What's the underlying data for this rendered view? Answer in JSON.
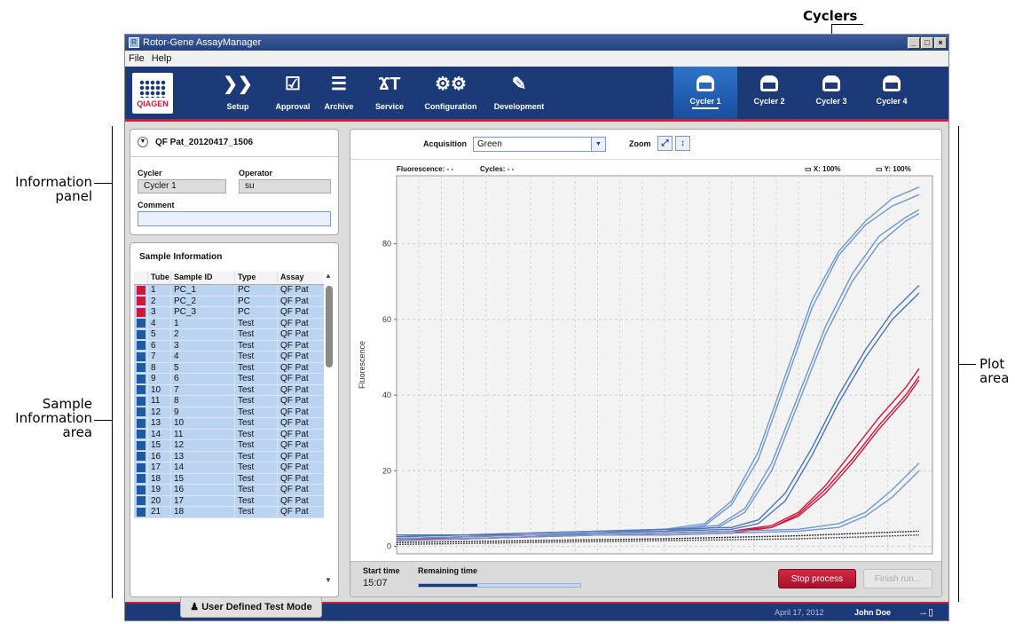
{
  "callouts": {
    "cyclers": "Cyclers",
    "information_panel": [
      "Information",
      "panel"
    ],
    "sample_information_area": [
      "Sample",
      "Information",
      "area"
    ],
    "plot_area": [
      "Plot",
      "area"
    ]
  },
  "window": {
    "title": "Rotor-Gene AssayManager",
    "controls": [
      "_",
      "□",
      "×"
    ]
  },
  "menu": [
    "File",
    "Help"
  ],
  "toolbar": {
    "logo": "QIAGEN",
    "tools": [
      {
        "label": "Setup",
        "icon": "setup-chevrons-icon",
        "glyph": "❯❯"
      },
      {
        "label": "Approval",
        "icon": "approval-check-icon",
        "glyph": "☑"
      },
      {
        "label": "Archive",
        "icon": "archive-cabinet-icon",
        "glyph": "☰"
      },
      {
        "label": "Service",
        "icon": "service-tools-icon",
        "glyph": "ϪT"
      },
      {
        "label": "Configuration",
        "icon": "configuration-gears-icon",
        "glyph": "⚙⚙"
      },
      {
        "label": "Development",
        "icon": "development-edit-icon",
        "glyph": "✎"
      }
    ],
    "cyclers": [
      "Cycler 1",
      "Cycler 2",
      "Cycler 3",
      "Cycler 4"
    ],
    "active_cycler": 0
  },
  "info_panel": {
    "experiment": "QF Pat_20120417_1506",
    "cycler_label": "Cycler",
    "cycler_value": "Cycler 1",
    "operator_label": "Operator",
    "operator_value": "su",
    "comment_label": "Comment",
    "comment_value": ""
  },
  "sample_panel": {
    "title": "Sample Information",
    "columns": [
      "Tube",
      "Sample ID",
      "Type",
      "Assay"
    ],
    "rows": [
      {
        "tube": "1",
        "id": "PC_1",
        "type": "PC",
        "assay": "QF Pat",
        "color": "#d1163a"
      },
      {
        "tube": "2",
        "id": "PC_2",
        "type": "PC",
        "assay": "QF Pat",
        "color": "#d1163a"
      },
      {
        "tube": "3",
        "id": "PC_3",
        "type": "PC",
        "assay": "QF Pat",
        "color": "#d1163a"
      },
      {
        "tube": "4",
        "id": "1",
        "type": "Test",
        "assay": "QF Pat",
        "color": "#1e5aa8"
      },
      {
        "tube": "5",
        "id": "2",
        "type": "Test",
        "assay": "QF Pat",
        "color": "#1e5aa8"
      },
      {
        "tube": "6",
        "id": "3",
        "type": "Test",
        "assay": "QF Pat",
        "color": "#1e5aa8"
      },
      {
        "tube": "7",
        "id": "4",
        "type": "Test",
        "assay": "QF Pat",
        "color": "#1e5aa8"
      },
      {
        "tube": "8",
        "id": "5",
        "type": "Test",
        "assay": "QF Pat",
        "color": "#1e5aa8"
      },
      {
        "tube": "9",
        "id": "6",
        "type": "Test",
        "assay": "QF Pat",
        "color": "#1e5aa8"
      },
      {
        "tube": "10",
        "id": "7",
        "type": "Test",
        "assay": "QF Pat",
        "color": "#1e5aa8"
      },
      {
        "tube": "11",
        "id": "8",
        "type": "Test",
        "assay": "QF Pat",
        "color": "#1e5aa8"
      },
      {
        "tube": "12",
        "id": "9",
        "type": "Test",
        "assay": "QF Pat",
        "color": "#1e5aa8"
      },
      {
        "tube": "13",
        "id": "10",
        "type": "Test",
        "assay": "QF Pat",
        "color": "#1e5aa8"
      },
      {
        "tube": "14",
        "id": "11",
        "type": "Test",
        "assay": "QF Pat",
        "color": "#1e5aa8"
      },
      {
        "tube": "15",
        "id": "12",
        "type": "Test",
        "assay": "QF Pat",
        "color": "#1e5aa8"
      },
      {
        "tube": "16",
        "id": "13",
        "type": "Test",
        "assay": "QF Pat",
        "color": "#1e5aa8"
      },
      {
        "tube": "17",
        "id": "14",
        "type": "Test",
        "assay": "QF Pat",
        "color": "#1e5aa8"
      },
      {
        "tube": "18",
        "id": "15",
        "type": "Test",
        "assay": "QF Pat",
        "color": "#1e5aa8"
      },
      {
        "tube": "19",
        "id": "16",
        "type": "Test",
        "assay": "QF Pat",
        "color": "#1e5aa8"
      },
      {
        "tube": "20",
        "id": "17",
        "type": "Test",
        "assay": "QF Pat",
        "color": "#1e5aa8"
      },
      {
        "tube": "21",
        "id": "18",
        "type": "Test",
        "assay": "QF Pat",
        "color": "#1e5aa8"
      }
    ]
  },
  "plot_panel": {
    "acquisition_label": "Acquisition",
    "acquisition_value": "Green",
    "zoom_label": "Zoom",
    "fluorescence_readout": "Fluorescence: - -",
    "cycles_readout": "Cycles: - -",
    "x_zoom": "X: 100%",
    "y_zoom": "Y: 100%",
    "start_time_label": "Start time",
    "start_time_value": "15:07",
    "remaining_label": "Remaining time",
    "remaining_progress": 0.36,
    "stop_button": "Stop process",
    "finish_button": "Finish run..."
  },
  "chart_data": {
    "type": "line",
    "ylabel": "Fluorescence",
    "xlabel": "",
    "ylim": [
      -2,
      98
    ],
    "xlim": [
      0,
      40
    ],
    "y_ticks": [
      0,
      20,
      40,
      60,
      80
    ],
    "grid": true,
    "series": [
      {
        "color": "#6f97cf",
        "x": [
          0,
          5,
          10,
          15,
          20,
          23,
          25,
          27,
          29,
          31,
          33,
          35,
          37,
          39
        ],
        "y": [
          3,
          3,
          3.5,
          4,
          4.5,
          6,
          12,
          25,
          45,
          65,
          78,
          86,
          92,
          95
        ]
      },
      {
        "color": "#6f97cf",
        "x": [
          0,
          5,
          10,
          15,
          20,
          23,
          25,
          27,
          29,
          31,
          33,
          35,
          37,
          39
        ],
        "y": [
          2.5,
          3,
          3,
          3.5,
          4,
          5.5,
          11,
          23,
          43,
          63,
          77,
          85,
          90,
          93
        ]
      },
      {
        "color": "#6f97cf",
        "x": [
          0,
          5,
          10,
          15,
          20,
          24,
          26,
          28,
          30,
          32,
          34,
          36,
          38,
          39
        ],
        "y": [
          2,
          2.5,
          3,
          3.5,
          4.5,
          5.5,
          10,
          22,
          40,
          58,
          72,
          82,
          87,
          89
        ]
      },
      {
        "color": "#6f97cf",
        "x": [
          0,
          5,
          10,
          15,
          20,
          24,
          26,
          28,
          30,
          32,
          34,
          36,
          38,
          39
        ],
        "y": [
          2,
          2.5,
          3,
          3.5,
          4,
          5,
          9,
          20,
          38,
          56,
          70,
          80,
          86,
          88
        ]
      },
      {
        "color": "#4a76b8",
        "x": [
          0,
          5,
          10,
          15,
          20,
          25,
          27,
          29,
          31,
          33,
          35,
          37,
          39
        ],
        "y": [
          3,
          3,
          3.5,
          4,
          4.5,
          5,
          7,
          14,
          26,
          40,
          52,
          62,
          69
        ]
      },
      {
        "color": "#4a76b8",
        "x": [
          0,
          5,
          10,
          15,
          20,
          25,
          27,
          29,
          31,
          33,
          35,
          37,
          39
        ],
        "y": [
          2.5,
          3,
          3,
          3.5,
          4,
          4.5,
          6,
          12,
          24,
          38,
          50,
          60,
          67
        ]
      },
      {
        "color": "#d1163a",
        "x": [
          0,
          5,
          10,
          15,
          20,
          25,
          28,
          30,
          32,
          34,
          36,
          38,
          39
        ],
        "y": [
          2,
          2.5,
          3,
          3,
          3.5,
          4,
          5.5,
          9,
          16,
          25,
          34,
          42,
          47
        ]
      },
      {
        "color": "#d1163a",
        "x": [
          0,
          5,
          10,
          15,
          20,
          25,
          28,
          30,
          32,
          34,
          36,
          38,
          39
        ],
        "y": [
          1.5,
          2,
          2.5,
          3,
          3,
          3.5,
          5,
          8,
          14,
          22,
          31,
          39,
          44
        ]
      },
      {
        "color": "#d1163a",
        "x": [
          0,
          5,
          10,
          15,
          20,
          25,
          28,
          30,
          32,
          34,
          36,
          38,
          39
        ],
        "y": [
          2,
          2,
          2.5,
          3,
          3.5,
          4,
          5,
          8.5,
          15,
          23,
          32,
          40,
          45
        ]
      },
      {
        "color": "#6f97cf",
        "x": [
          0,
          5,
          10,
          15,
          20,
          25,
          30,
          33,
          35,
          37,
          39
        ],
        "y": [
          2,
          2.5,
          3,
          3,
          3.5,
          4,
          4.5,
          6,
          9,
          15,
          22
        ]
      },
      {
        "color": "#6f97cf",
        "x": [
          0,
          5,
          10,
          15,
          20,
          25,
          30,
          33,
          35,
          37,
          39
        ],
        "y": [
          1.5,
          2,
          2.5,
          3,
          3,
          3.5,
          4,
          5,
          8,
          13,
          20
        ]
      },
      {
        "color": "#333333",
        "x": [
          0,
          10,
          20,
          30,
          35,
          39
        ],
        "y": [
          1,
          1.5,
          2,
          2.8,
          3.5,
          4
        ]
      },
      {
        "color": "#555555",
        "x": [
          0,
          10,
          20,
          30,
          35,
          39
        ],
        "y": [
          0.5,
          1,
          1.5,
          2,
          2.5,
          3
        ]
      }
    ]
  },
  "statusbar": {
    "mode": "User Defined Test Mode",
    "date": "April 17, 2012",
    "user": "John Doe",
    "logout_glyph": "→▯"
  }
}
